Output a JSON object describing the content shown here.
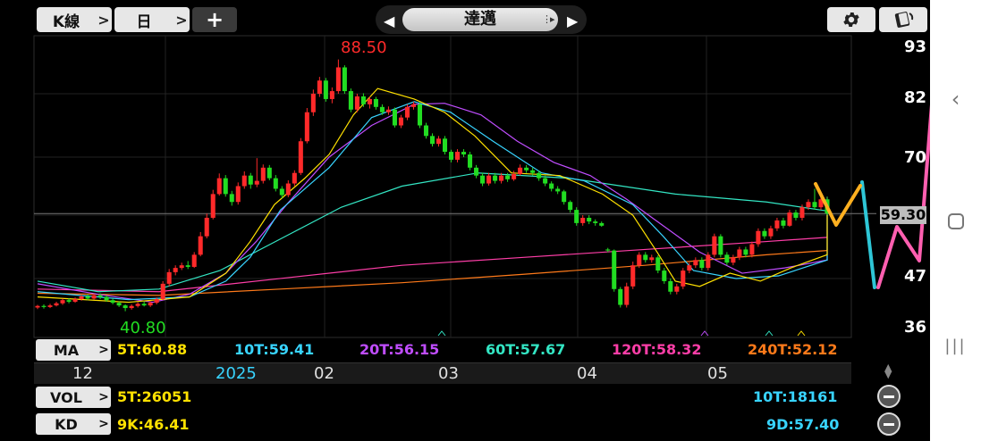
{
  "toolbar": {
    "kline_label": "K線",
    "period_label": "日",
    "add_label": "+",
    "stock_name": "達邁"
  },
  "chart": {
    "high_label": "88.50",
    "low_label": "40.80",
    "last_price": "59.30",
    "y_ticks": [
      "93",
      "82",
      "70",
      "59",
      "47",
      "36"
    ],
    "x_ticks": [
      "12",
      "2025",
      "02",
      "03",
      "04",
      "05"
    ]
  },
  "ma_row": {
    "label": "MA",
    "items": [
      {
        "text": "5T:60.88",
        "color": "#ffe100"
      },
      {
        "text": "10T:59.41",
        "color": "#38d4ff"
      },
      {
        "text": "20T:56.15",
        "color": "#c04dff"
      },
      {
        "text": "60T:57.67",
        "color": "#33e6c4"
      },
      {
        "text": "120T:58.32",
        "color": "#ff3ea8"
      },
      {
        "text": "240T:52.12",
        "color": "#ff7a1a"
      }
    ]
  },
  "vol_row": {
    "label": "VOL",
    "left": "5T:26051",
    "right": "10T:18161"
  },
  "kd_row": {
    "label": "KD",
    "left": "9K:46.41",
    "right": "9D:57.40"
  },
  "chart_data": {
    "type": "candlestick",
    "ylim": [
      36,
      93
    ],
    "y_ticks": [
      36,
      47,
      59,
      70,
      82,
      93
    ],
    "annotations": {
      "high": 88.5,
      "low": 40.8,
      "last": 59.3
    },
    "candles": [
      [
        41.5,
        41.8,
        42.0,
        41.2
      ],
      [
        41.8,
        41.6,
        42.1,
        41.3
      ],
      [
        41.6,
        41.9,
        42.2,
        41.4
      ],
      [
        41.9,
        42.3,
        42.6,
        41.7
      ],
      [
        42.3,
        42.9,
        43.2,
        42.0
      ],
      [
        42.9,
        42.6,
        43.3,
        42.3
      ],
      [
        42.6,
        43.1,
        43.4,
        42.4
      ],
      [
        43.1,
        43.6,
        43.9,
        42.8
      ],
      [
        43.6,
        43.2,
        44.0,
        42.9
      ],
      [
        43.2,
        43.8,
        44.1,
        43.0
      ],
      [
        43.8,
        43.5,
        44.2,
        43.1
      ],
      [
        43.5,
        42.9,
        43.8,
        42.6
      ],
      [
        42.9,
        42.4,
        43.2,
        42.1
      ],
      [
        42.4,
        41.9,
        42.7,
        41.6
      ],
      [
        41.9,
        41.4,
        42.1,
        40.8
      ],
      [
        41.4,
        41.8,
        42.1,
        41.1
      ],
      [
        41.8,
        42.2,
        42.5,
        41.5
      ],
      [
        42.2,
        41.9,
        42.6,
        41.7
      ],
      [
        41.9,
        42.4,
        42.7,
        41.6
      ],
      [
        42.4,
        43.1,
        43.4,
        42.1
      ],
      [
        43.1,
        46.0,
        46.5,
        42.9
      ],
      [
        46.0,
        48.2,
        48.8,
        45.5
      ],
      [
        48.2,
        49.0,
        49.5,
        47.6
      ],
      [
        49.0,
        49.5,
        50.0,
        48.6
      ],
      [
        49.5,
        49.2,
        50.3,
        48.8
      ],
      [
        49.2,
        51.5,
        52.0,
        49.0
      ],
      [
        51.5,
        55.0,
        55.8,
        51.2
      ],
      [
        55.0,
        58.5,
        59.3,
        54.6
      ],
      [
        58.5,
        63.0,
        63.8,
        58.2
      ],
      [
        63.0,
        66.0,
        66.9,
        62.7
      ],
      [
        66.0,
        63.0,
        66.6,
        62.5
      ],
      [
        63.0,
        61.5,
        63.6,
        60.8
      ],
      [
        61.5,
        64.5,
        65.2,
        61.0
      ],
      [
        64.5,
        66.5,
        67.3,
        64.0
      ],
      [
        66.5,
        64.8,
        67.0,
        64.0
      ],
      [
        64.8,
        65.5,
        69.8,
        64.3
      ],
      [
        65.5,
        68.0,
        68.6,
        65.0
      ],
      [
        68.0,
        66.0,
        68.5,
        65.6
      ],
      [
        66.0,
        64.0,
        66.6,
        63.5
      ],
      [
        64.0,
        62.8,
        64.5,
        62.2
      ],
      [
        62.8,
        65.0,
        65.6,
        62.4
      ],
      [
        65.0,
        67.0,
        67.5,
        64.5
      ],
      [
        67.0,
        73.0,
        73.6,
        66.6
      ],
      [
        73.0,
        78.5,
        79.3,
        72.6
      ],
      [
        78.5,
        82.0,
        82.8,
        77.8
      ],
      [
        82.0,
        84.5,
        85.2,
        81.4
      ],
      [
        84.5,
        81.0,
        85.0,
        80.5
      ],
      [
        81.0,
        82.5,
        83.2,
        80.2
      ],
      [
        82.5,
        87.0,
        88.5,
        82.0
      ],
      [
        87.0,
        82.5,
        87.4,
        82.0
      ],
      [
        82.5,
        79.0,
        83.0,
        78.5
      ],
      [
        79.0,
        81.5,
        82.0,
        78.5
      ],
      [
        81.5,
        80.0,
        82.1,
        79.5
      ],
      [
        80.0,
        81.0,
        81.5,
        79.2
      ],
      [
        81.0,
        79.5,
        81.4,
        79.0
      ],
      [
        79.5,
        78.5,
        80.0,
        78.0
      ],
      [
        78.5,
        79.0,
        79.6,
        78.0
      ],
      [
        79.0,
        76.0,
        79.4,
        75.6
      ],
      [
        76.0,
        77.5,
        78.0,
        75.5
      ],
      [
        77.5,
        79.5,
        80.0,
        77.0
      ],
      [
        79.5,
        80.0,
        80.5,
        79.0
      ],
      [
        80.0,
        76.0,
        80.4,
        75.5
      ],
      [
        76.0,
        74.0,
        76.5,
        73.5
      ],
      [
        74.0,
        72.5,
        74.5,
        72.0
      ],
      [
        72.5,
        73.5,
        74.0,
        72.0
      ],
      [
        73.5,
        71.0,
        74.0,
        70.5
      ],
      [
        71.0,
        69.5,
        71.4,
        69.0
      ],
      [
        69.5,
        71.0,
        71.5,
        69.0
      ],
      [
        71.0,
        70.5,
        71.5,
        70.0
      ],
      [
        70.5,
        68.0,
        71.0,
        67.5
      ],
      [
        68.0,
        66.5,
        68.5,
        66.0
      ],
      [
        66.5,
        65.0,
        67.0,
        64.5
      ],
      [
        65.0,
        66.5,
        67.0,
        64.6
      ],
      [
        66.5,
        65.5,
        67.0,
        65.0
      ],
      [
        65.5,
        66.5,
        67.0,
        65.0
      ],
      [
        66.5,
        65.8,
        67.0,
        65.3
      ],
      [
        65.8,
        66.8,
        67.4,
        65.5
      ],
      [
        66.8,
        68.0,
        68.6,
        66.5
      ],
      [
        68.0,
        67.5,
        68.5,
        67.0
      ],
      [
        67.5,
        67.0,
        68.0,
        66.5
      ],
      [
        67.0,
        66.0,
        67.4,
        65.5
      ],
      [
        66.0,
        65.0,
        66.5,
        64.5
      ],
      [
        65.0,
        64.0,
        65.4,
        63.5
      ],
      [
        64.0,
        63.5,
        64.5,
        63.0
      ],
      [
        63.5,
        61.5,
        63.8,
        61.0
      ],
      [
        61.5,
        60.0,
        61.8,
        59.5
      ],
      [
        60.0,
        57.5,
        60.5,
        57.0
      ],
      [
        57.5,
        58.5,
        59.0,
        57.0
      ],
      [
        58.5,
        57.8,
        59.0,
        57.3
      ],
      [
        57.8,
        57.5,
        58.2,
        57.0
      ],
      [
        57.5,
        57.0,
        57.8,
        56.8
      ],
      [
        52.5,
        52.3,
        52.8,
        52.0
      ],
      [
        52.3,
        45.0,
        52.5,
        44.5
      ],
      [
        45.0,
        42.0,
        45.4,
        41.5
      ],
      [
        42.0,
        45.5,
        46.2,
        41.5
      ],
      [
        45.5,
        49.5,
        50.2,
        45.0
      ],
      [
        49.5,
        51.5,
        52.0,
        49.0
      ],
      [
        51.5,
        50.5,
        52.0,
        50.0
      ],
      [
        50.5,
        51.0,
        51.5,
        50.0
      ],
      [
        51.0,
        48.5,
        51.4,
        48.0
      ],
      [
        48.5,
        46.5,
        49.0,
        46.0
      ],
      [
        46.5,
        44.5,
        47.0,
        44.0
      ],
      [
        44.5,
        45.5,
        46.0,
        44.0
      ],
      [
        45.5,
        48.5,
        49.0,
        45.0
      ],
      [
        48.5,
        49.5,
        50.0,
        48.0
      ],
      [
        49.5,
        50.5,
        51.0,
        49.0
      ],
      [
        50.5,
        49.0,
        51.0,
        48.5
      ],
      [
        49.0,
        51.5,
        52.0,
        48.5
      ],
      [
        51.5,
        55.0,
        55.5,
        51.0
      ],
      [
        55.0,
        51.5,
        55.4,
        51.0
      ],
      [
        51.5,
        50.0,
        52.0,
        49.5
      ],
      [
        50.0,
        51.0,
        51.5,
        49.5
      ],
      [
        51.0,
        52.5,
        53.0,
        50.5
      ],
      [
        52.5,
        51.5,
        53.0,
        51.0
      ],
      [
        51.5,
        53.5,
        54.0,
        51.0
      ],
      [
        53.5,
        56.0,
        56.5,
        53.0
      ],
      [
        56.0,
        55.0,
        56.5,
        54.5
      ],
      [
        55.0,
        56.5,
        57.0,
        54.5
      ],
      [
        56.5,
        58.0,
        58.5,
        56.0
      ],
      [
        58.0,
        57.0,
        58.5,
        56.5
      ],
      [
        57.0,
        59.5,
        60.0,
        56.8
      ],
      [
        59.5,
        58.5,
        60.0,
        58.0
      ],
      [
        58.5,
        60.5,
        61.0,
        58.0
      ],
      [
        60.5,
        61.5,
        62.0,
        60.0
      ],
      [
        61.5,
        60.5,
        64.0,
        60.0
      ],
      [
        60.5,
        62.0,
        62.5,
        60.0
      ],
      [
        62.0,
        59.3,
        62.5,
        59.0
      ]
    ],
    "series": [
      {
        "name": "5T",
        "color": "#ffe100"
      },
      {
        "name": "10T",
        "color": "#38d4ff"
      },
      {
        "name": "20T",
        "color": "#c04dff"
      },
      {
        "name": "60T",
        "color": "#33e6c4"
      },
      {
        "name": "120T",
        "color": "#ff3ea8"
      },
      {
        "name": "240T",
        "color": "#ff7a1a"
      }
    ],
    "ma60_points": [
      [
        0,
        46.5
      ],
      [
        20,
        44.5
      ],
      [
        40,
        45.0
      ],
      [
        60,
        48.5
      ],
      [
        80,
        54.5
      ],
      [
        100,
        60.5
      ],
      [
        120,
        64.5
      ],
      [
        145,
        67.0
      ],
      [
        175,
        66.0
      ],
      [
        210,
        63.0
      ],
      [
        240,
        61.5
      ],
      [
        260,
        59.8
      ]
    ],
    "ma120_points": [
      [
        0,
        45.0
      ],
      [
        40,
        44.5
      ],
      [
        80,
        47.0
      ],
      [
        120,
        49.5
      ],
      [
        160,
        51.0
      ],
      [
        200,
        52.5
      ],
      [
        240,
        54.0
      ],
      [
        260,
        54.8
      ]
    ],
    "ma240_points": [
      [
        0,
        44.2
      ],
      [
        40,
        43.8
      ],
      [
        80,
        45.0
      ],
      [
        120,
        46.2
      ],
      [
        160,
        47.8
      ],
      [
        200,
        49.5
      ],
      [
        240,
        51.5
      ],
      [
        260,
        52.3
      ]
    ],
    "ma20_points": [
      [
        0,
        46.0
      ],
      [
        20,
        44.0
      ],
      [
        38,
        42.5
      ],
      [
        50,
        44.0
      ],
      [
        62,
        48.0
      ],
      [
        72,
        54.0
      ],
      [
        82,
        61.0
      ],
      [
        96,
        70.0
      ],
      [
        110,
        76.0
      ],
      [
        124,
        80.0
      ],
      [
        134,
        80.2
      ],
      [
        146,
        78.0
      ],
      [
        158,
        73.0
      ],
      [
        170,
        69.0
      ],
      [
        182,
        66.5
      ],
      [
        194,
        62.0
      ],
      [
        206,
        57.0
      ],
      [
        218,
        52.0
      ],
      [
        232,
        48.0
      ],
      [
        246,
        49.0
      ],
      [
        260,
        50.5
      ],
      [
        274,
        52.5
      ],
      [
        290,
        54.5
      ],
      [
        306,
        57.0
      ],
      [
        322,
        60.0
      ],
      [
        334,
        62.5
      ]
    ],
    "ma10_points": [
      [
        0,
        44.5
      ],
      [
        30,
        43.0
      ],
      [
        50,
        43.5
      ],
      [
        62,
        46.5
      ],
      [
        70,
        51.0
      ],
      [
        80,
        60.0
      ],
      [
        96,
        68.0
      ],
      [
        110,
        77.5
      ],
      [
        124,
        80.5
      ],
      [
        136,
        78.5
      ],
      [
        150,
        73.0
      ],
      [
        166,
        67.0
      ],
      [
        180,
        65.5
      ],
      [
        196,
        61.0
      ],
      [
        206,
        55.0
      ],
      [
        216,
        48.5
      ],
      [
        230,
        47.0
      ],
      [
        244,
        47.5
      ],
      [
        260,
        50.5
      ],
      [
        276,
        53.5
      ],
      [
        290,
        56.0
      ],
      [
        306,
        57.5
      ],
      [
        322,
        59.5
      ],
      [
        334,
        60.5
      ]
    ],
    "ma5_points": [
      [
        0,
        43.5
      ],
      [
        30,
        42.5
      ],
      [
        50,
        43.5
      ],
      [
        62,
        48.0
      ],
      [
        70,
        54.0
      ],
      [
        78,
        61.0
      ],
      [
        88,
        66.0
      ],
      [
        96,
        70.5
      ],
      [
        104,
        78.0
      ],
      [
        112,
        83.0
      ],
      [
        124,
        81.0
      ],
      [
        134,
        78.5
      ],
      [
        144,
        74.0
      ],
      [
        156,
        67.0
      ],
      [
        172,
        66.5
      ],
      [
        186,
        63.0
      ],
      [
        196,
        59.0
      ],
      [
        204,
        52.0
      ],
      [
        210,
        46.5
      ],
      [
        218,
        45.5
      ],
      [
        228,
        48.0
      ],
      [
        238,
        46.5
      ],
      [
        248,
        49.0
      ],
      [
        260,
        51.5
      ],
      [
        276,
        54.5
      ],
      [
        290,
        57.5
      ],
      [
        306,
        59.0
      ],
      [
        322,
        60.5
      ],
      [
        334,
        60.9
      ]
    ],
    "overlay_polyline_cyan": [
      [
        964,
        204
      ],
      [
        978,
        322
      ]
    ],
    "overlay_polyline_orange": [
      [
        912,
        206
      ],
      [
        935,
        252
      ],
      [
        962,
        208
      ]
    ],
    "overlay_polyline_pink": [
      [
        982,
        322
      ],
      [
        1003,
        254
      ],
      [
        1028,
        292
      ],
      [
        1044,
        92
      ]
    ]
  }
}
